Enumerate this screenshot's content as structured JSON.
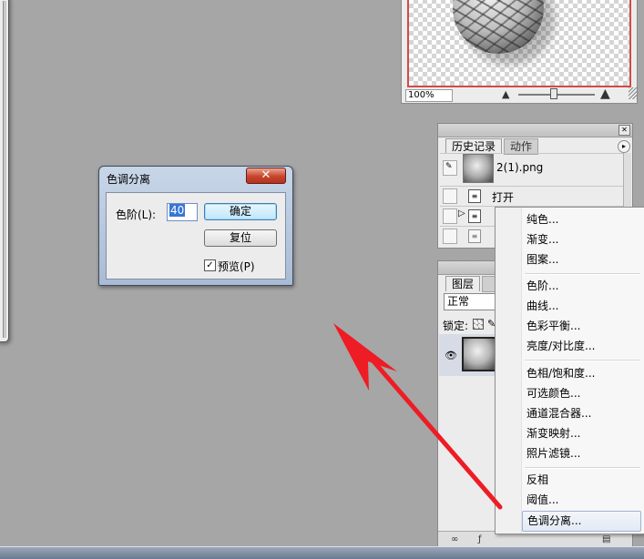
{
  "navigator": {
    "zoom": "100%",
    "zoom_out_icon": "mountain-small-icon",
    "zoom_in_icon": "mountain-large-icon"
  },
  "history": {
    "tab_history": "历史记录",
    "tab_actions": "动作",
    "snapshot_label": "2(1).png",
    "items": [
      "打开"
    ]
  },
  "layers": {
    "tab_layers": "图层",
    "blend_mode": "正常",
    "lock_label": "锁定:"
  },
  "adjustment_menu": {
    "groups": [
      [
        "纯色...",
        "渐变...",
        "图案..."
      ],
      [
        "色阶...",
        "曲线...",
        "色彩平衡...",
        "亮度/对比度..."
      ],
      [
        "色相/饱和度...",
        "可选颜色...",
        "通道混合器...",
        "渐变映射...",
        "照片滤镜..."
      ],
      [
        "反相",
        "阈值...",
        "色调分离..."
      ]
    ],
    "selected": "色调分离..."
  },
  "dialog": {
    "title": "色调分离",
    "close_symbol": "✕",
    "level_label": "色阶(L):",
    "level_value": "40",
    "ok_label": "确定",
    "reset_label": "复位",
    "preview_label": "预览(P)",
    "preview_checked": true
  },
  "colors": {
    "arrow": "#ee1c24",
    "menu_highlight": "#e2eaf4",
    "close_button": "#c8452c"
  }
}
